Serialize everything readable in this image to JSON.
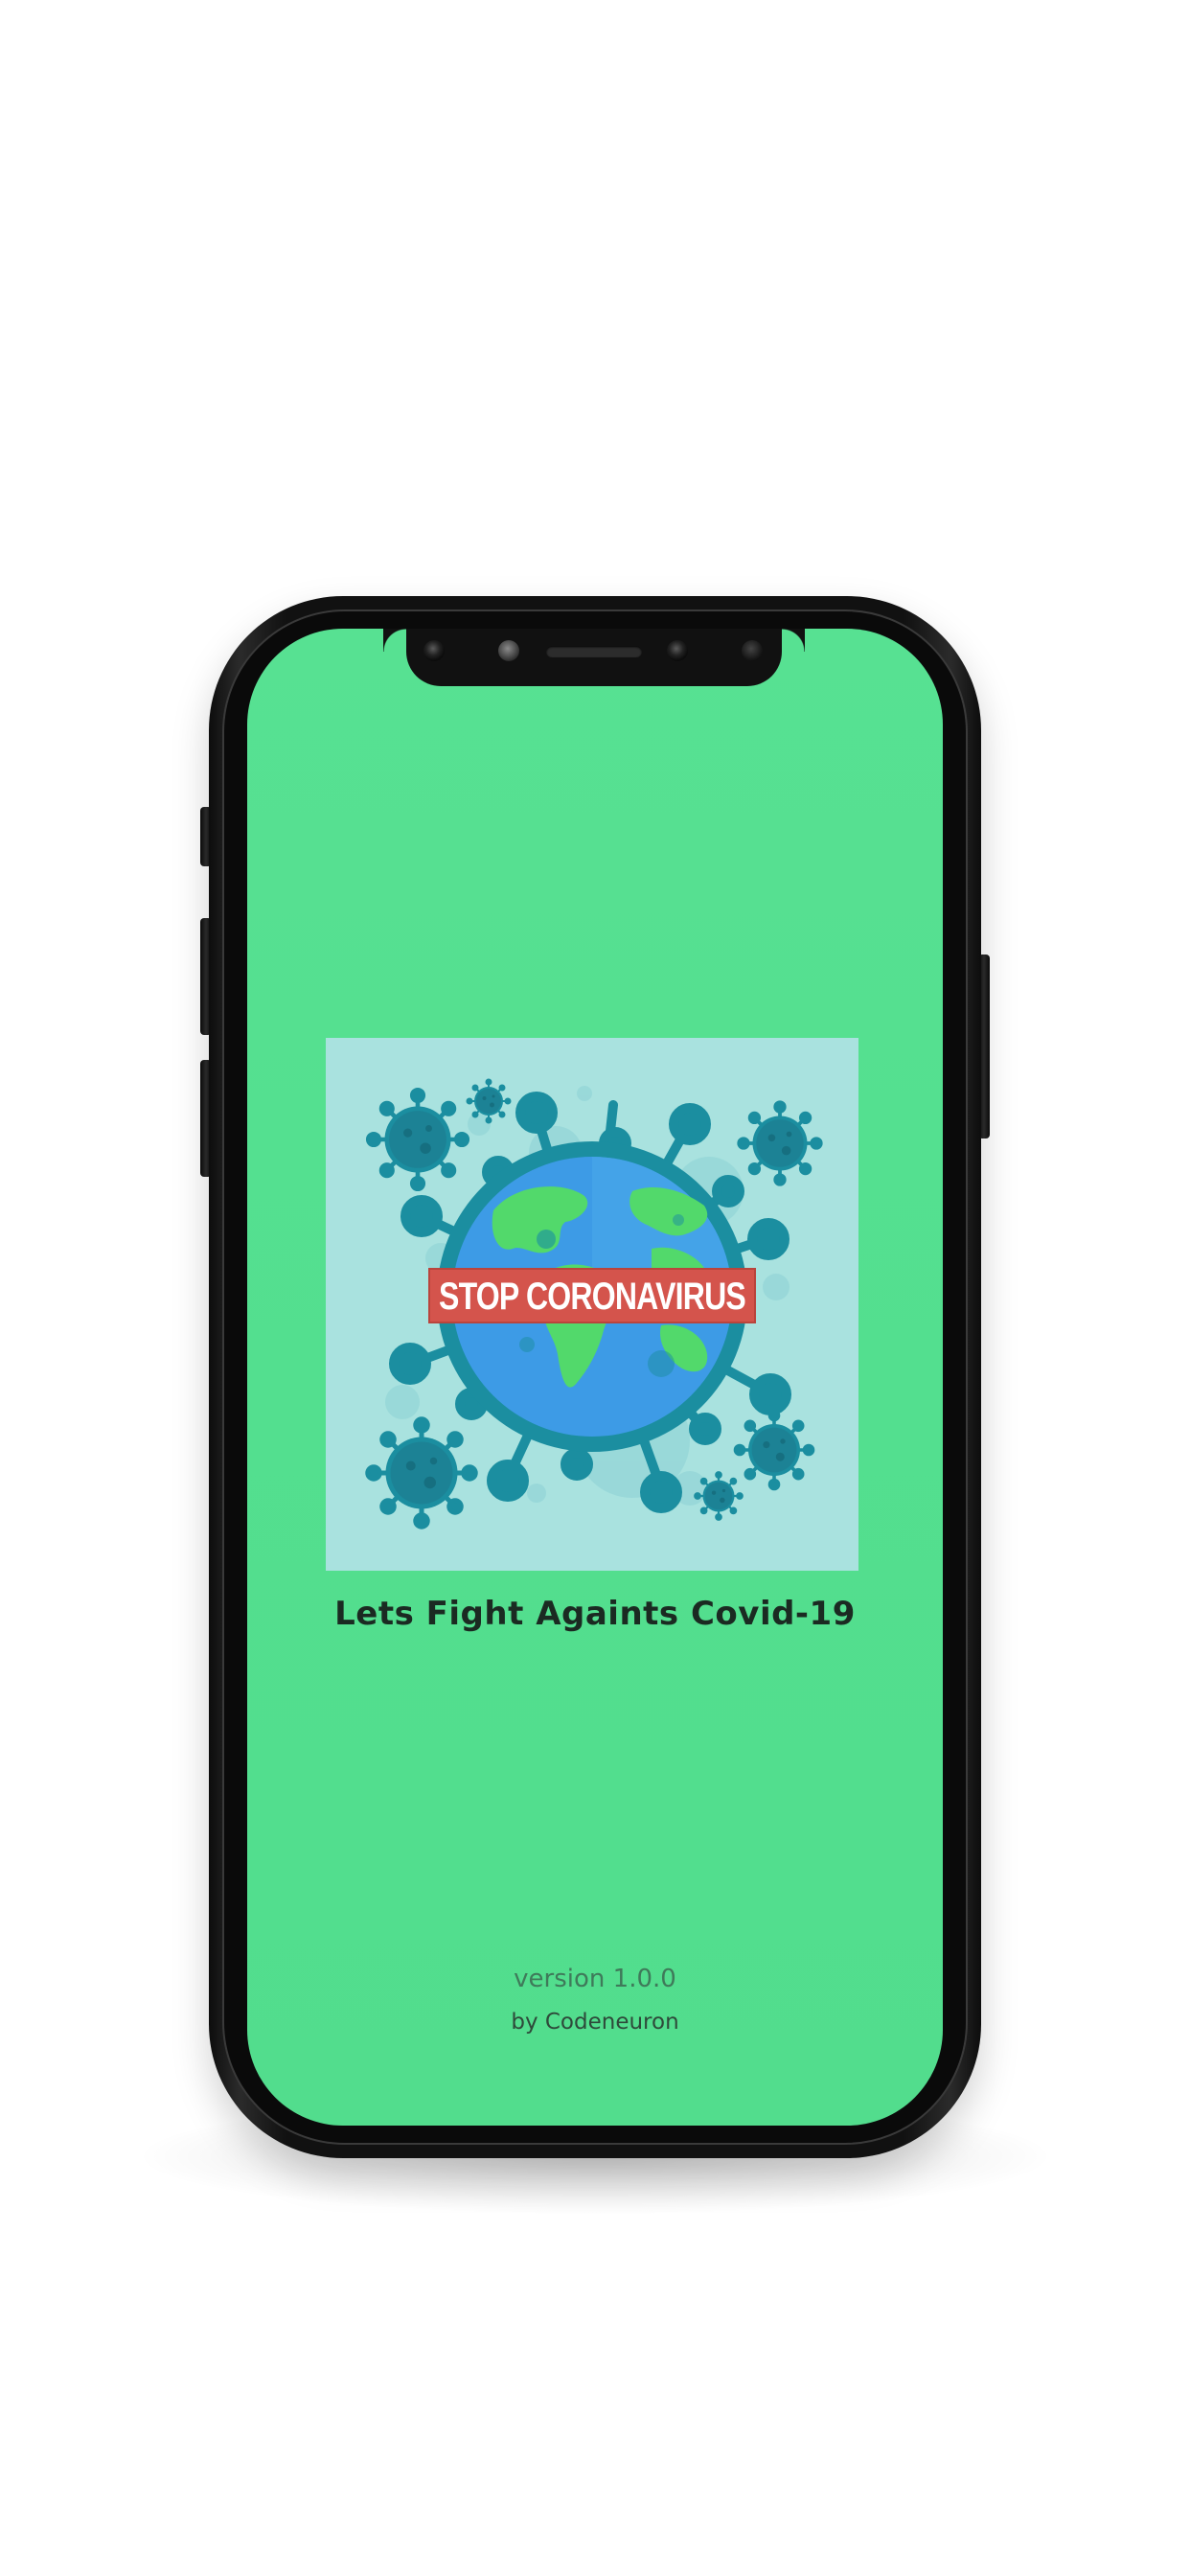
{
  "splash": {
    "hero_banner_text": "STOP CORONAVIRUS",
    "tagline": "Lets Fight Againts Covid-19",
    "version": "version 1.0.0",
    "author": "by Codeneuron"
  },
  "colors": {
    "screen_background": "#55e091",
    "hero_background": "#a9e2df",
    "virus": "#1b8ea0",
    "globe_ocean": "#3d9be6",
    "globe_land": "#52d96b",
    "banner": "#d4544c",
    "tagline_text": "#1b2a22"
  },
  "icons": {
    "hero_image": "virus-globe-illustration"
  }
}
